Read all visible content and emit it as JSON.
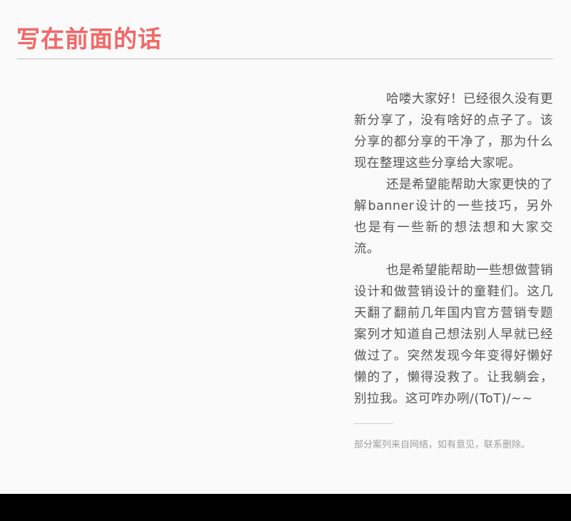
{
  "header": {
    "title": "写在前面的话"
  },
  "article": {
    "paragraphs": [
      "哈喽大家好！已经很久没有更新分享了，没有啥好的点子了。该分享的都分享的干净了，那为什么现在整理这些分享给大家呢。",
      "还是希望能帮助大家更快的了解banner设计的一些技巧，另外也是有一些新的想法想和大家交流。",
      "也是希望能帮助一些想做营销设计和做营销设计的童鞋们。这几天翻了翻前几年国内官方营销专题案列才知道自己想法别人早就已经做过了。突然发现今年变得好懒好懒的了，懒得没救了。让我躺会，别拉我。这可咋办咧/(ToT)/~~"
    ],
    "footnote": "部分案列来自网络，如有意见，联系删除。"
  },
  "colors": {
    "title": "#f46666",
    "body_text": "#555555",
    "footnote": "#9e9e9e",
    "background": "#fafafa",
    "bottom_bar": "#000000"
  }
}
